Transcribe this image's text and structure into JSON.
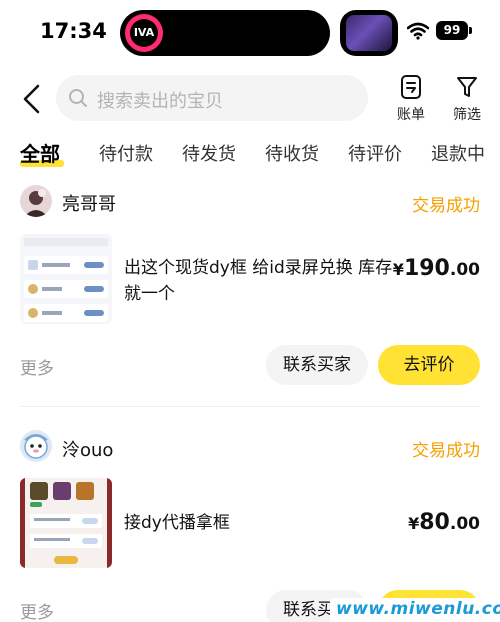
{
  "status_bar": {
    "time": "17:34",
    "island_logo_text": "IVA",
    "battery": "99",
    "icons": [
      "wifi-icon",
      "battery-icon"
    ]
  },
  "header": {
    "search_placeholder": "搜索卖出的宝贝",
    "bill_label": "账单",
    "filter_label": "筛选",
    "icons": [
      "back-icon",
      "search-icon",
      "bill-icon",
      "filter-icon"
    ]
  },
  "tabs": [
    "全部",
    "待付款",
    "待发货",
    "待收货",
    "待评价",
    "退款中"
  ],
  "active_tab": "全部",
  "orders": [
    {
      "buyer": "亮哥哥",
      "status": "交易成功",
      "title": "出这个现货dy框 给id录屏兑换 库存就一个",
      "price_symbol": "¥",
      "price_int": "190",
      "price_dec": ".00",
      "more": "更多",
      "contact_btn": "联系买家",
      "review_btn": "去评价"
    },
    {
      "buyer": "泠ouo",
      "status": "交易成功",
      "title": "接dy代播拿框",
      "price_symbol": "¥",
      "price_int": "80",
      "price_dec": ".00",
      "more": "更多",
      "contact_btn": "联系买家",
      "review_btn": "去评价"
    }
  ],
  "watermark": "www.miwenlu.com",
  "colors": {
    "accent_yellow": "#ffe233",
    "status_orange": "#f5a000",
    "watermark_blue": "#1a9ad6"
  }
}
